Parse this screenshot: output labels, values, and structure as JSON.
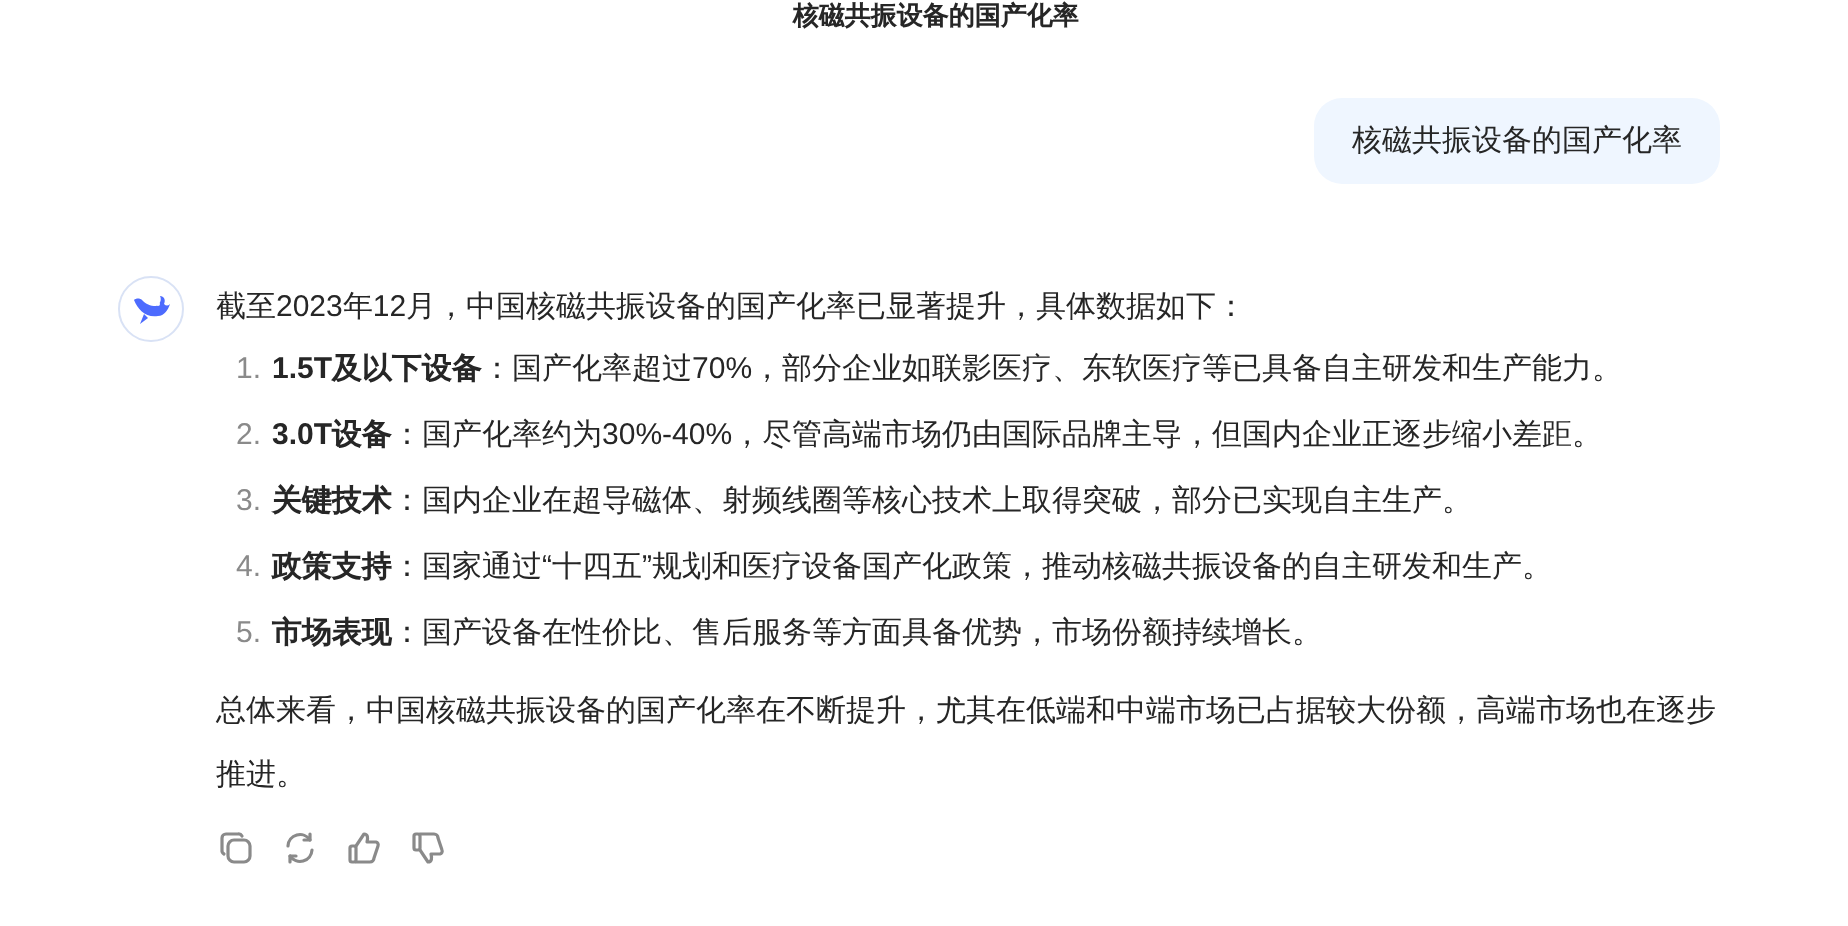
{
  "header": {
    "title": "核磁共振设备的国产化率"
  },
  "user_message": "核磁共振设备的国产化率",
  "reply": {
    "intro": "截至2023年12月，中国核磁共振设备的国产化率已显著提升，具体数据如下：",
    "items": [
      {
        "number": "1.",
        "text": "**1.5T及以下设备**：国产化率超过70%，部分企业如联影医疗、东软医疗等已具备自主研发和生产能力。"
      },
      {
        "number": "2.",
        "text": "**3.0T设备**：国产化率约为30%-40%，尽管高端市场仍由国际品牌主导，但国内企业正逐步缩小差距。"
      },
      {
        "number": "3.",
        "text": "**关键技术**：国内企业在超导磁体、射频线圈等核心技术上取得突破，部分已实现自主生产。"
      },
      {
        "number": "4.",
        "text": "**政策支持**：国家通过“十四五”规划和医疗设备国产化政策，推动核磁共振设备的自主研发和生产。"
      },
      {
        "number": "5.",
        "text": "**市场表现**：国产设备在性价比、售后服务等方面具备优势，市场份额持续增长。"
      }
    ],
    "summary": "总体来看，中国核磁共振设备的国产化率在不断提升，尤其在低端和中端市场已占据较大份额，高端市场也在逐步推进。"
  },
  "actions": [
    {
      "kind": "copy"
    },
    {
      "kind": "regenerate"
    },
    {
      "kind": "like"
    },
    {
      "kind": "dislike"
    }
  ]
}
